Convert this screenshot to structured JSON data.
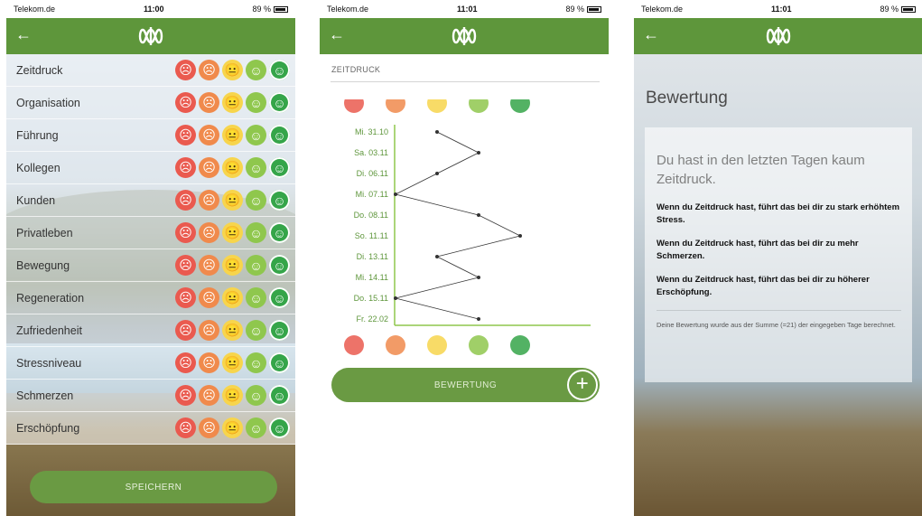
{
  "statusbar": [
    {
      "carrier": "Telekom.de",
      "time": "11:00",
      "battery": "89 %"
    },
    {
      "carrier": "Telekom.de",
      "time": "11:01",
      "battery": "89 %"
    },
    {
      "carrier": "Telekom.de",
      "time": "11:01",
      "battery": "89 %"
    }
  ],
  "colors": {
    "brand": "#5e963b",
    "red": "#ea5a4f",
    "orange": "#f08a4c",
    "yellow": "#f7d54c",
    "lightgreen": "#8fc74d",
    "green": "#35a549"
  },
  "screen1": {
    "items": [
      {
        "label": "Zeitdruck"
      },
      {
        "label": "Organisation"
      },
      {
        "label": "Führung"
      },
      {
        "label": "Kollegen"
      },
      {
        "label": "Kunden"
      },
      {
        "label": "Privatleben"
      },
      {
        "label": "Bewegung"
      },
      {
        "label": "Regeneration"
      },
      {
        "label": "Zufriedenheit"
      },
      {
        "label": "Stressniveau"
      },
      {
        "label": "Schmerzen"
      },
      {
        "label": "Erschöpfung"
      }
    ],
    "save_label": "SPEICHERN"
  },
  "screen2": {
    "title": "ZEITDRUCK",
    "button_label": "BEWERTUNG",
    "chart_data": {
      "type": "line",
      "categories": [
        "Mi. 31.10",
        "Sa. 03.11",
        "Di. 06.11",
        "Mi. 07.11",
        "Do. 08.11",
        "So. 11.11",
        "Di. 13.11",
        "Mi. 14.11",
        "Do. 15.11",
        "Fr. 22.02"
      ],
      "values": [
        3,
        4,
        3,
        2,
        4,
        5,
        3,
        4,
        2,
        4
      ],
      "x_scale": [
        "very-bad",
        "bad",
        "neutral",
        "good",
        "very-good"
      ],
      "orientation": "horizontal"
    }
  },
  "screen3": {
    "heading": "Bewertung",
    "lead": "Du hast in den letzten Tagen kaum Zeitdruck.",
    "paragraphs": [
      "Wenn du Zeitdruck hast, führt das bei dir zu stark erhöhtem Stress.",
      "Wenn du Zeitdruck hast, führt das bei dir zu mehr Schmerzen.",
      "Wenn du Zeitdruck hast, führt das bei dir zu höherer Erschöpfung."
    ],
    "footnote": "Deine Bewertung wurde aus der Summe (=21) der eingegeben Tage berechnet."
  }
}
